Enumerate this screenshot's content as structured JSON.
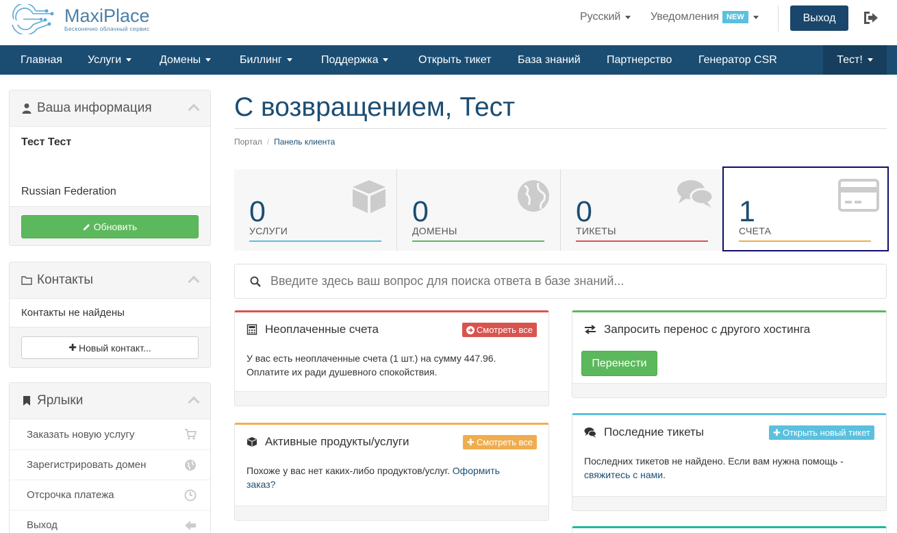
{
  "brand": {
    "name": "MaxiPlace",
    "tagline": "Бесконечно облачный сервис"
  },
  "header": {
    "language": "Русский",
    "notifications": "Уведомления",
    "new_badge": "NEW",
    "logout": "Выход"
  },
  "nav": {
    "items": [
      {
        "label": "Главная"
      },
      {
        "label": "Услуги"
      },
      {
        "label": "Домены"
      },
      {
        "label": "Биллинг"
      },
      {
        "label": "Поддержка"
      },
      {
        "label": "Открыть тикет"
      },
      {
        "label": "База знаний"
      },
      {
        "label": "Партнерство"
      },
      {
        "label": "Генератор CSR"
      }
    ],
    "user": "Тест!"
  },
  "sidebar": {
    "info": {
      "title": "Ваша информация",
      "name": "Тест Тест",
      "country": "Russian Federation",
      "update": "Обновить"
    },
    "contacts": {
      "title": "Контакты",
      "empty": "Контакты не найдены",
      "new": "Новый контакт..."
    },
    "shortcuts": {
      "title": "Ярлыки",
      "items": [
        {
          "label": "Заказать новую услугу"
        },
        {
          "label": "Зарегистрировать домен"
        },
        {
          "label": "Отсрочка платежа"
        },
        {
          "label": "Выход"
        }
      ]
    }
  },
  "main": {
    "title": "С возвращением, Тест",
    "breadcrumb": {
      "home": "Портал",
      "current": "Панель клиента"
    },
    "tiles": [
      {
        "value": "0",
        "label": "УСЛУГИ",
        "color": "#5bc0de"
      },
      {
        "value": "0",
        "label": "ДОМЕНЫ",
        "color": "#5cb85c"
      },
      {
        "value": "0",
        "label": "ТИКЕТЫ",
        "color": "#d9534f"
      },
      {
        "value": "1",
        "label": "СЧЕТА",
        "color": "#f0ad4e"
      }
    ],
    "search_placeholder": "Введите здесь ваш вопрос для поиска ответа в базе знаний...",
    "unpaid": {
      "title": "Неоплаченные счета",
      "button": "Смотреть все",
      "line1": "У вас есть неоплаченные счета (1 шт.) на сумму 447.96.",
      "line2": "Оплатите их ради душевного спокойствия."
    },
    "transfer": {
      "title": "Запросить перенос с другого хостинга",
      "button": "Перенести"
    },
    "products": {
      "title": "Активные продукты/услуги",
      "button": "Смотреть все",
      "text": "Похоже у вас нет каких-либо продуктов/услуг.",
      "link1": "Оформить",
      "link2": "заказ?"
    },
    "tickets": {
      "title": "Последние тикеты",
      "button": "Открыть новый тикет",
      "text": "Последних тикетов не найдено. Если вам нужна помощь -",
      "link": "свяжитесь с нами",
      "period": "."
    }
  }
}
